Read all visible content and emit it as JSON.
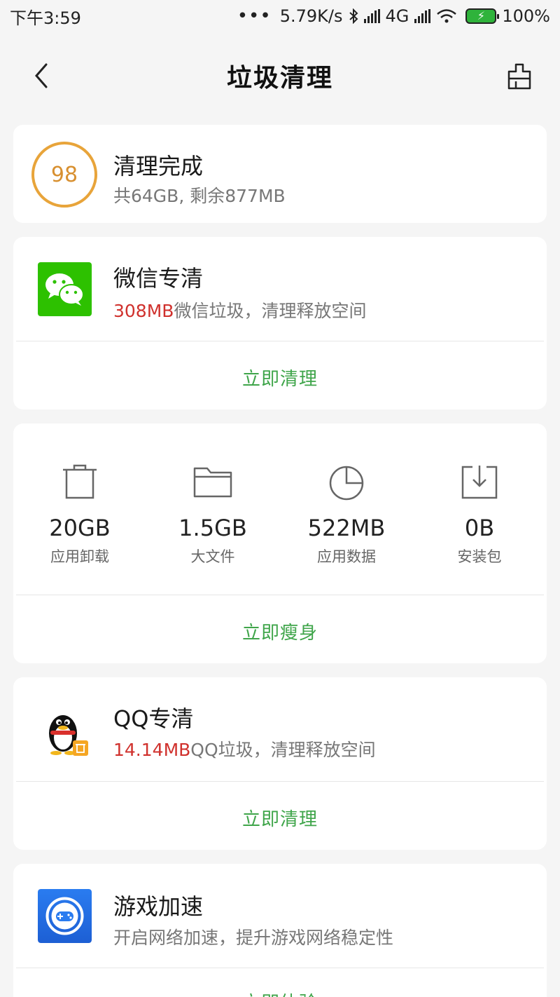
{
  "status_bar": {
    "time": "下午3:59",
    "dots": "•••",
    "speed": "5.79K/s",
    "network": "4G",
    "battery": "100%"
  },
  "header": {
    "title": "垃圾清理"
  },
  "summary": {
    "score": "98",
    "title": "清理完成",
    "subtitle": "共64GB, 剩余877MB"
  },
  "wechat": {
    "title": "微信专清",
    "size": "308MB",
    "desc": "微信垃圾，清理释放空间",
    "action": "立即清理"
  },
  "slim": {
    "items": [
      {
        "value": "20GB",
        "label": "应用卸载",
        "icon": "trash-icon"
      },
      {
        "value": "1.5GB",
        "label": "大文件",
        "icon": "folder-icon"
      },
      {
        "value": "522MB",
        "label": "应用数据",
        "icon": "pie-chart-icon"
      },
      {
        "value": "0B",
        "label": "安装包",
        "icon": "download-box-icon"
      }
    ],
    "action": "立即瘦身"
  },
  "qq": {
    "title": "QQ专清",
    "size": "14.14MB",
    "desc": "QQ垃圾，清理释放空间",
    "action": "立即清理"
  },
  "game": {
    "title": "游戏加速",
    "desc": "开启网络加速，提升游戏网络稳定性",
    "action": "立即体验"
  },
  "colors": {
    "accent_green": "#3fa54a",
    "highlight_red": "#d0312d",
    "score_orange": "#e8a43a"
  }
}
